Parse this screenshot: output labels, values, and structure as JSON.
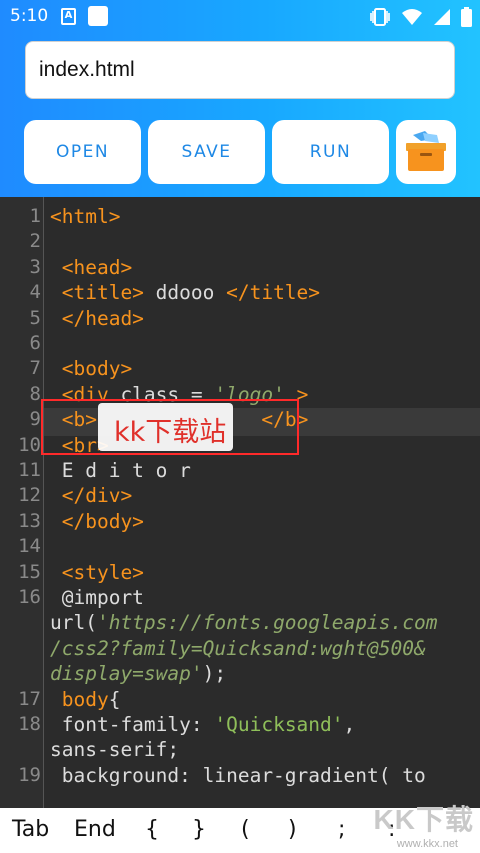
{
  "status_bar": {
    "time": "5:10",
    "icons": [
      "notification-a-icon",
      "app-square-icon",
      "vibrate-icon",
      "wifi-icon",
      "signal-icon",
      "battery-icon"
    ]
  },
  "file": {
    "name": "index.html"
  },
  "toolbar": {
    "open_label": "OPEN",
    "save_label": "SAVE",
    "run_label": "RUN",
    "files_icon": "folder-box-icon"
  },
  "editor": {
    "line_numbers": [
      "1",
      "2",
      "3",
      "4",
      "5",
      "6",
      "7",
      "8",
      "9",
      "10",
      "11",
      "12",
      "13",
      "14",
      "15",
      "16",
      "17",
      "18",
      "19"
    ],
    "lines": [
      {
        "n": "1",
        "parts": [
          {
            "t": "<html>",
            "c": "tag"
          }
        ]
      },
      {
        "n": "2",
        "parts": []
      },
      {
        "n": "3",
        "parts": [
          {
            "t": " <head>",
            "c": "tag"
          }
        ]
      },
      {
        "n": "4",
        "parts": [
          {
            "t": " <title>",
            "c": "tag"
          },
          {
            "t": " ddooo ",
            "c": "txt"
          },
          {
            "t": "</title>",
            "c": "tag"
          }
        ]
      },
      {
        "n": "5",
        "parts": [
          {
            "t": " </head>",
            "c": "tag"
          }
        ]
      },
      {
        "n": "6",
        "parts": []
      },
      {
        "n": "7",
        "parts": [
          {
            "t": " <body>",
            "c": "tag"
          }
        ]
      },
      {
        "n": "8",
        "parts": [
          {
            "t": " <div",
            "c": "tag"
          },
          {
            "t": " class = ",
            "c": "txt"
          },
          {
            "t": "'logo'",
            "c": "str"
          },
          {
            "t": " >",
            "c": "tag"
          }
        ]
      },
      {
        "n": "9",
        "parts": [
          {
            "t": " <b>",
            "c": "tag"
          },
          {
            "t": "              ",
            "c": "txt"
          },
          {
            "t": "</b>",
            "c": "tag"
          }
        ]
      },
      {
        "n": "10",
        "parts": [
          {
            "t": " <br>",
            "c": "tag"
          }
        ]
      },
      {
        "n": "11",
        "parts": [
          {
            "t": " E d i t o r",
            "c": "txt"
          }
        ]
      },
      {
        "n": "12",
        "parts": [
          {
            "t": " </div>",
            "c": "tag"
          }
        ]
      },
      {
        "n": "13",
        "parts": [
          {
            "t": " </body>",
            "c": "tag"
          }
        ]
      },
      {
        "n": "14",
        "parts": []
      },
      {
        "n": "15",
        "parts": [
          {
            "t": " <style>",
            "c": "tag"
          }
        ]
      },
      {
        "n": "16",
        "parts": [
          {
            "t": " @import",
            "c": "txt"
          }
        ]
      },
      {
        "n": "",
        "parts": [
          {
            "t": "url(",
            "c": "txt"
          },
          {
            "t": "'https://fonts.googleapis.com",
            "c": "str"
          }
        ]
      },
      {
        "n": "",
        "parts": [
          {
            "t": "/css2?family=Quicksand:wght@500&",
            "c": "str"
          }
        ]
      },
      {
        "n": "",
        "parts": [
          {
            "t": "display=swap'",
            "c": "str"
          },
          {
            "t": ");",
            "c": "txt"
          }
        ]
      },
      {
        "n": "17",
        "parts": [
          {
            "t": " body",
            "c": "tag"
          },
          {
            "t": "{",
            "c": "txt"
          }
        ]
      },
      {
        "n": "18",
        "parts": [
          {
            "t": " font-family: ",
            "c": "txt"
          },
          {
            "t": "'Quicksand'",
            "c": "grn"
          },
          {
            "t": ",",
            "c": "txt"
          }
        ]
      },
      {
        "n": "",
        "parts": [
          {
            "t": "sans-serif;",
            "c": "txt"
          }
        ]
      },
      {
        "n": "19",
        "parts": [
          {
            "t": " background: linear-gradient( to",
            "c": "txt"
          }
        ]
      }
    ]
  },
  "watermark": {
    "text": "kk下载站",
    "corner_text": "KK下载",
    "corner_url": "www.kkx.net"
  },
  "keys": [
    {
      "label": "Tab",
      "name": "key-tab"
    },
    {
      "label": "End",
      "name": "key-end"
    },
    {
      "label": "{",
      "name": "key-left-brace"
    },
    {
      "label": "}",
      "name": "key-right-brace"
    },
    {
      "label": "(",
      "name": "key-left-paren"
    },
    {
      "label": ")",
      "name": "key-right-paren"
    },
    {
      "label": ";",
      "name": "key-semicolon"
    },
    {
      "label": ":",
      "name": "key-colon"
    }
  ],
  "colors": {
    "header_start": "#1f8bff",
    "header_end": "#22c3ff",
    "accent": "#1e88e5",
    "tag": "#f7931e",
    "string": "#8fa96b",
    "editor_bg": "#2b2b2b"
  }
}
